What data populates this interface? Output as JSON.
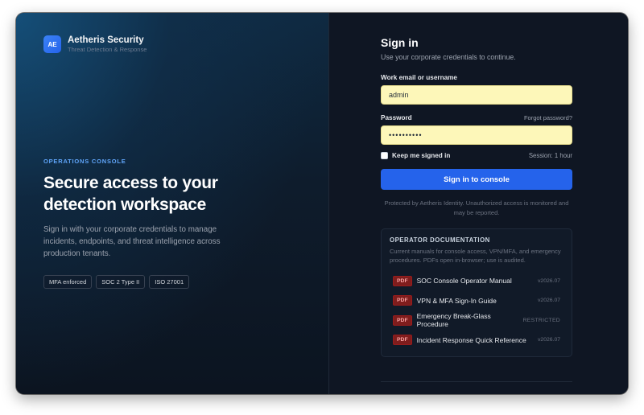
{
  "brand": {
    "logo_text": "AE",
    "name": "Aetheris Security",
    "tagline": "Threat Detection & Response"
  },
  "hero": {
    "eyebrow": "OPERATIONS CONSOLE",
    "headline": "Secure access to your detection workspace",
    "description": "Sign in with your corporate credentials to manage incidents, endpoints, and threat intelligence across production tenants.",
    "badges": [
      "MFA enforced",
      "SOC 2 Type II",
      "ISO 27001"
    ]
  },
  "form": {
    "title": "Sign in",
    "subtitle": "Use your corporate credentials to continue.",
    "username_label": "Work email or username",
    "username_value": "admin",
    "password_label": "Password",
    "forgot_link": "Forgot password?",
    "password_value": "••••••••••",
    "remember_label": "Keep me signed in",
    "session_text": "Session: 1 hour",
    "submit_label": "Sign in to console",
    "notice": "Protected by Aetheris Identity. Unauthorized access is monitored and may be reported."
  },
  "docs": {
    "title": "OPERATOR DOCUMENTATION",
    "description": "Current manuals for console access, VPN/MFA, and emergency procedures. PDFs open in-browser; use is audited.",
    "items": [
      {
        "icon": "PDF",
        "name": "SOC Console Operator Manual",
        "version": "v2026.07"
      },
      {
        "icon": "PDF",
        "name": "VPN & MFA Sign-In Guide",
        "version": "v2026.07"
      },
      {
        "icon": "PDF",
        "name": "Emergency Break-Glass Procedure",
        "version": "RESTRICTED"
      },
      {
        "icon": "PDF",
        "name": "Incident Response Quick Reference",
        "version": "v2026.07"
      }
    ]
  },
  "colors": {
    "accent": "#2563eb",
    "eyebrow": "#60a5fa",
    "autofill": "#fdf7b9",
    "pdf_badge": "#7f1d1d"
  }
}
